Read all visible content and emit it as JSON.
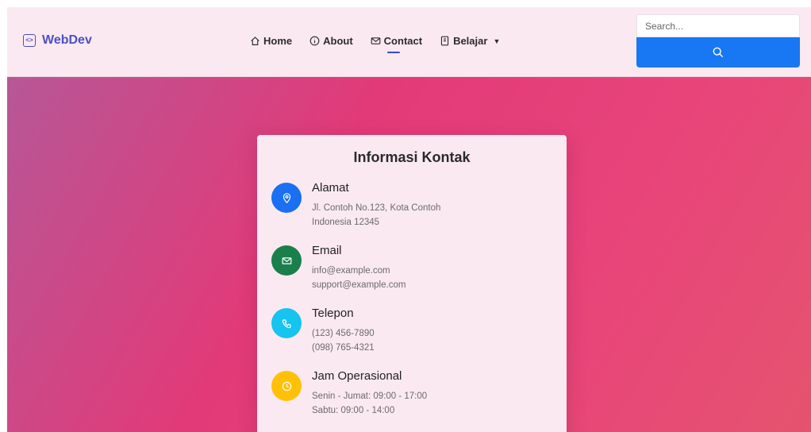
{
  "brand": {
    "name": "WebDev",
    "icon": "code-icon"
  },
  "nav": {
    "items": [
      {
        "label": "Home",
        "icon": "home-icon"
      },
      {
        "label": "About",
        "icon": "info-icon"
      },
      {
        "label": "Contact",
        "icon": "envelope-icon",
        "active": true
      },
      {
        "label": "Belajar",
        "icon": "book-icon",
        "dropdown": true
      }
    ],
    "active_color": "#3b47c9"
  },
  "search": {
    "placeholder": "Search...",
    "button_color": "#1877f2"
  },
  "card": {
    "title": "Informasi Kontak",
    "items": [
      {
        "title": "Alamat",
        "icon": "location-pin-icon",
        "color": "#1a6ff2",
        "lines": [
          "Jl. Contoh No.123, Kota Contoh",
          "Indonesia 12345"
        ]
      },
      {
        "title": "Email",
        "icon": "envelope-icon",
        "color": "#1a7f4b",
        "lines": [
          "info@example.com",
          "support@example.com"
        ]
      },
      {
        "title": "Telepon",
        "icon": "phone-icon",
        "color": "#15c4ef",
        "lines": [
          "(123) 456-7890",
          "(098) 765-4321"
        ]
      },
      {
        "title": "Jam Operasional",
        "icon": "clock-icon",
        "color": "#ffc107",
        "lines": [
          "Senin - Jumat: 09:00 - 17:00",
          "Sabtu: 09:00 - 14:00"
        ]
      }
    ]
  },
  "colors": {
    "brand": "#4b4fc7",
    "navbar_bg": "#fbe9f1",
    "card_bg": "#fbe9f1"
  }
}
